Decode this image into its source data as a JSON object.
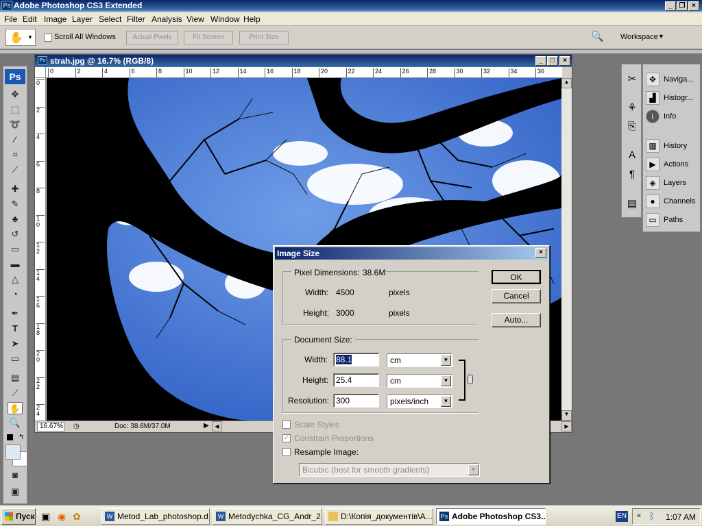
{
  "app": {
    "title": "Adobe Photoshop CS3 Extended",
    "logo": "Ps"
  },
  "menu": [
    "File",
    "Edit",
    "Image",
    "Layer",
    "Select",
    "Filter",
    "Analysis",
    "View",
    "Window",
    "Help"
  ],
  "options_bar": {
    "scroll_all_label": "Scroll All Windows",
    "actual_pixels": "Actual Pixels",
    "fit_screen": "Fit Screen",
    "print_size": "Print Size",
    "workspace": "Workspace"
  },
  "document": {
    "title": "strah.jpg @ 16.7% (RGB/8)",
    "zoom": "16.67%",
    "doc_info": "Doc: 38.6M/37.0M",
    "ruler_top": [
      "0",
      "2",
      "4",
      "6",
      "8",
      "10",
      "12",
      "14",
      "16",
      "18",
      "20",
      "22",
      "24",
      "26",
      "28",
      "30",
      "32",
      "34",
      "36"
    ],
    "ruler_left": [
      "0",
      "2",
      "4",
      "6",
      "8",
      "10",
      "12",
      "14",
      "16",
      "18",
      "20",
      "22",
      "24"
    ]
  },
  "panels": {
    "group1": [
      {
        "label": "Naviga...",
        "icon": "navigator-icon"
      },
      {
        "label": "Histogr...",
        "icon": "histogram-icon"
      },
      {
        "label": "Info",
        "icon": "info-icon"
      }
    ],
    "group2": [
      {
        "label": "History",
        "icon": "history-icon"
      },
      {
        "label": "Actions",
        "icon": "actions-icon"
      },
      {
        "label": "Layers",
        "icon": "layers-icon"
      },
      {
        "label": "Channels",
        "icon": "channels-icon"
      },
      {
        "label": "Paths",
        "icon": "paths-icon"
      }
    ]
  },
  "dialog": {
    "title": "Image Size",
    "pixel_dimensions_label": "Pixel Dimensions:",
    "pixel_dimensions_value": "38.6M",
    "width_label": "Width:",
    "height_label": "Height:",
    "px_width": "4500",
    "px_height": "3000",
    "px_unit": "pixels",
    "document_size_label": "Document Size:",
    "doc_width": "88.1",
    "doc_height": "25.4",
    "resolution_label": "Resolution:",
    "resolution": "300",
    "unit_cm": "cm",
    "unit_res": "pixels/inch",
    "scale_styles": "Scale Styles",
    "constrain": "Constrain Proportions",
    "resample": "Resample Image:",
    "resample_method": "Bicubic (best for smooth gradients)",
    "ok": "OK",
    "cancel": "Cancel",
    "auto": "Auto..."
  },
  "taskbar": {
    "start": "Пуск",
    "tasks": [
      "Metod_Lab_photoshop.d...",
      "Metodychka_CG_Andr_2...",
      "D:\\Копія_документів\\A...",
      "Adobe Photoshop CS3..."
    ],
    "lang": "EN",
    "time": "1:07 AM"
  },
  "colors": {
    "sky": "#3d6fd1",
    "title_blue": "#0a246a",
    "dialog_bg": "#d4d0c8"
  }
}
